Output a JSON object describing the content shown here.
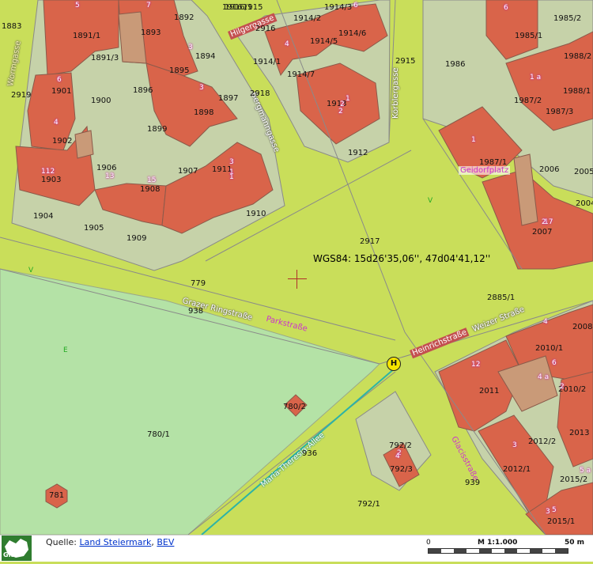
{
  "colors": {
    "road": "#c9de5a",
    "building": "#d9644a",
    "building_annex": "#c99a78",
    "plot": "#c6d2a9",
    "park": "#b4e2a6",
    "tram_line": "#2db3a6",
    "parcel_line": "#8a8a8a",
    "street_label_text": "#ffffff",
    "symbol_green": "#22aa22",
    "house_number": "#f2d6ee",
    "poi_label": "#cc33cc"
  },
  "coordinate_readout": "WGS84: 15d26'35,06'', 47d04'41,12''",
  "streets": {
    "hilgergasse": "Hilgergasse",
    "wormgasse": "Wormgasse",
    "bergmanngasse": "Bergmanngasse",
    "koerblergasse": "Körblergasse",
    "grazer_ringstrasse": "Grazer Ringstraße",
    "parkstrasse": "Parkstraße",
    "heinrichstrasse": "Heinrichstraße",
    "weizer_strasse": "Weizer Straße",
    "glacisstrasse": "Glacisstraße",
    "maria_theresia_allee": "Maria-Theresia-Allee",
    "geidorfplatz": "Geidorfplatz"
  },
  "parcels": [
    "1883",
    "1891/1",
    "1893",
    "1892",
    "1916",
    "1915",
    "1914/2",
    "1914/3",
    "1916/1",
    "2916",
    "1914/5",
    "1914/6",
    "1914/1",
    "1914/7",
    "1913",
    "2915",
    "1986",
    "1985/1",
    "1985/2",
    "1988/2",
    "1891/3",
    "1894",
    "2919",
    "1901",
    "1900",
    "1896",
    "1895",
    "1897",
    "2918",
    "1898",
    "1988/1",
    "1987/2",
    "1987/3",
    "1899",
    "1912",
    "1902",
    "1906",
    "1907",
    "1903",
    "1908",
    "1911",
    "1987/1",
    "2006",
    "2005",
    "1904",
    "1905",
    "1909",
    "1910",
    "2917",
    "2004",
    "2007",
    "779",
    "938",
    "2885/1",
    "2008",
    "2010/1",
    "2011",
    "2010/2",
    "780/2",
    "780/1",
    "792/2",
    "792/3",
    "936",
    "2012/2",
    "2013",
    "2012/1",
    "939",
    "2015/2",
    "781",
    "792/1",
    "2015/1"
  ],
  "house_numbers": [
    "5",
    "7",
    "3",
    "4",
    "6",
    "6",
    "4",
    "3",
    "1",
    "2",
    "1",
    "6",
    "1 a",
    "4",
    "6",
    "3",
    "1",
    "1",
    "13",
    "15",
    "3",
    "17",
    "2",
    "2",
    "4",
    "12",
    "4 a",
    "2",
    "2",
    "3",
    "5",
    "5 a",
    "112"
  ],
  "land_use_symbols": [
    "V",
    "V",
    "E"
  ],
  "poi": {
    "bus_stop": "H"
  },
  "footer": {
    "source_label": "Quelle:",
    "source_link1": "Land Steiermark",
    "separator": ",",
    "source_link2": "BEV",
    "logo_text": "GIS",
    "scale_start": "0",
    "scale_ratio": "M 1:1.000",
    "scale_end": "50 m"
  }
}
